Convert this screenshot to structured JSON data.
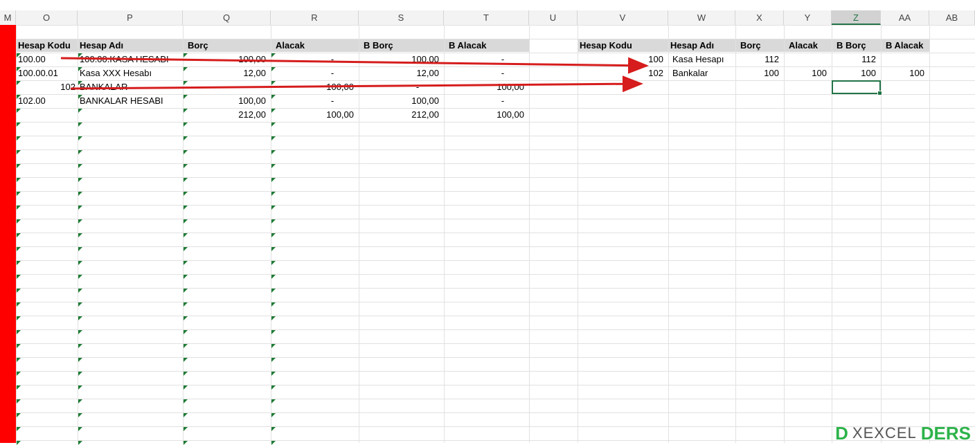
{
  "colors": {
    "accent": "#217346",
    "red_bar": "#ff0000",
    "arrow": "#d61c1c",
    "header_fill": "#d9d9d9",
    "logo_green": "#2db34a"
  },
  "columns": [
    {
      "id": "M",
      "label": "M"
    },
    {
      "id": "O",
      "label": "O"
    },
    {
      "id": "P",
      "label": "P"
    },
    {
      "id": "Q",
      "label": "Q"
    },
    {
      "id": "R",
      "label": "R"
    },
    {
      "id": "S",
      "label": "S"
    },
    {
      "id": "T",
      "label": "T"
    },
    {
      "id": "U",
      "label": "U"
    },
    {
      "id": "V",
      "label": "V"
    },
    {
      "id": "W",
      "label": "W"
    },
    {
      "id": "X",
      "label": "X"
    },
    {
      "id": "Y",
      "label": "Y"
    },
    {
      "id": "Z",
      "label": "Z"
    },
    {
      "id": "AA",
      "label": "AA"
    },
    {
      "id": "AB",
      "label": "AB"
    }
  ],
  "left_table": {
    "headers": [
      "Hesap Kodu",
      "Hesap Adı",
      "Borç",
      "Alacak",
      "B Borç",
      "B Alacak"
    ],
    "rows": [
      [
        "100.00",
        "100.00.KASA HESABI",
        "100,00",
        "-",
        "100,00",
        "-"
      ],
      [
        "100.00.01",
        "Kasa XXX Hesabı",
        "12,00",
        "-",
        "12,00",
        "-"
      ],
      [
        "102",
        "BANKALAR",
        "",
        "100,00",
        "-",
        "100,00"
      ],
      [
        "102.00",
        "BANKALAR HESABI",
        "100,00",
        "-",
        "100,00",
        "-"
      ],
      [
        "",
        "",
        "212,00",
        "100,00",
        "212,00",
        "100,00"
      ]
    ]
  },
  "right_table": {
    "headers": [
      "Hesap Kodu",
      "Hesap Adı",
      "Borç",
      "Alacak",
      "B Borç",
      "B Alacak"
    ],
    "rows": [
      [
        "100",
        "Kasa Hesapı",
        "112",
        "",
        "112",
        ""
      ],
      [
        "102",
        "Bankalar",
        "100",
        "100",
        "100",
        "100"
      ]
    ]
  },
  "selected_column": "Z",
  "logo": {
    "mark": "D",
    "text": "XEXCEL",
    "text2": "DERS"
  }
}
